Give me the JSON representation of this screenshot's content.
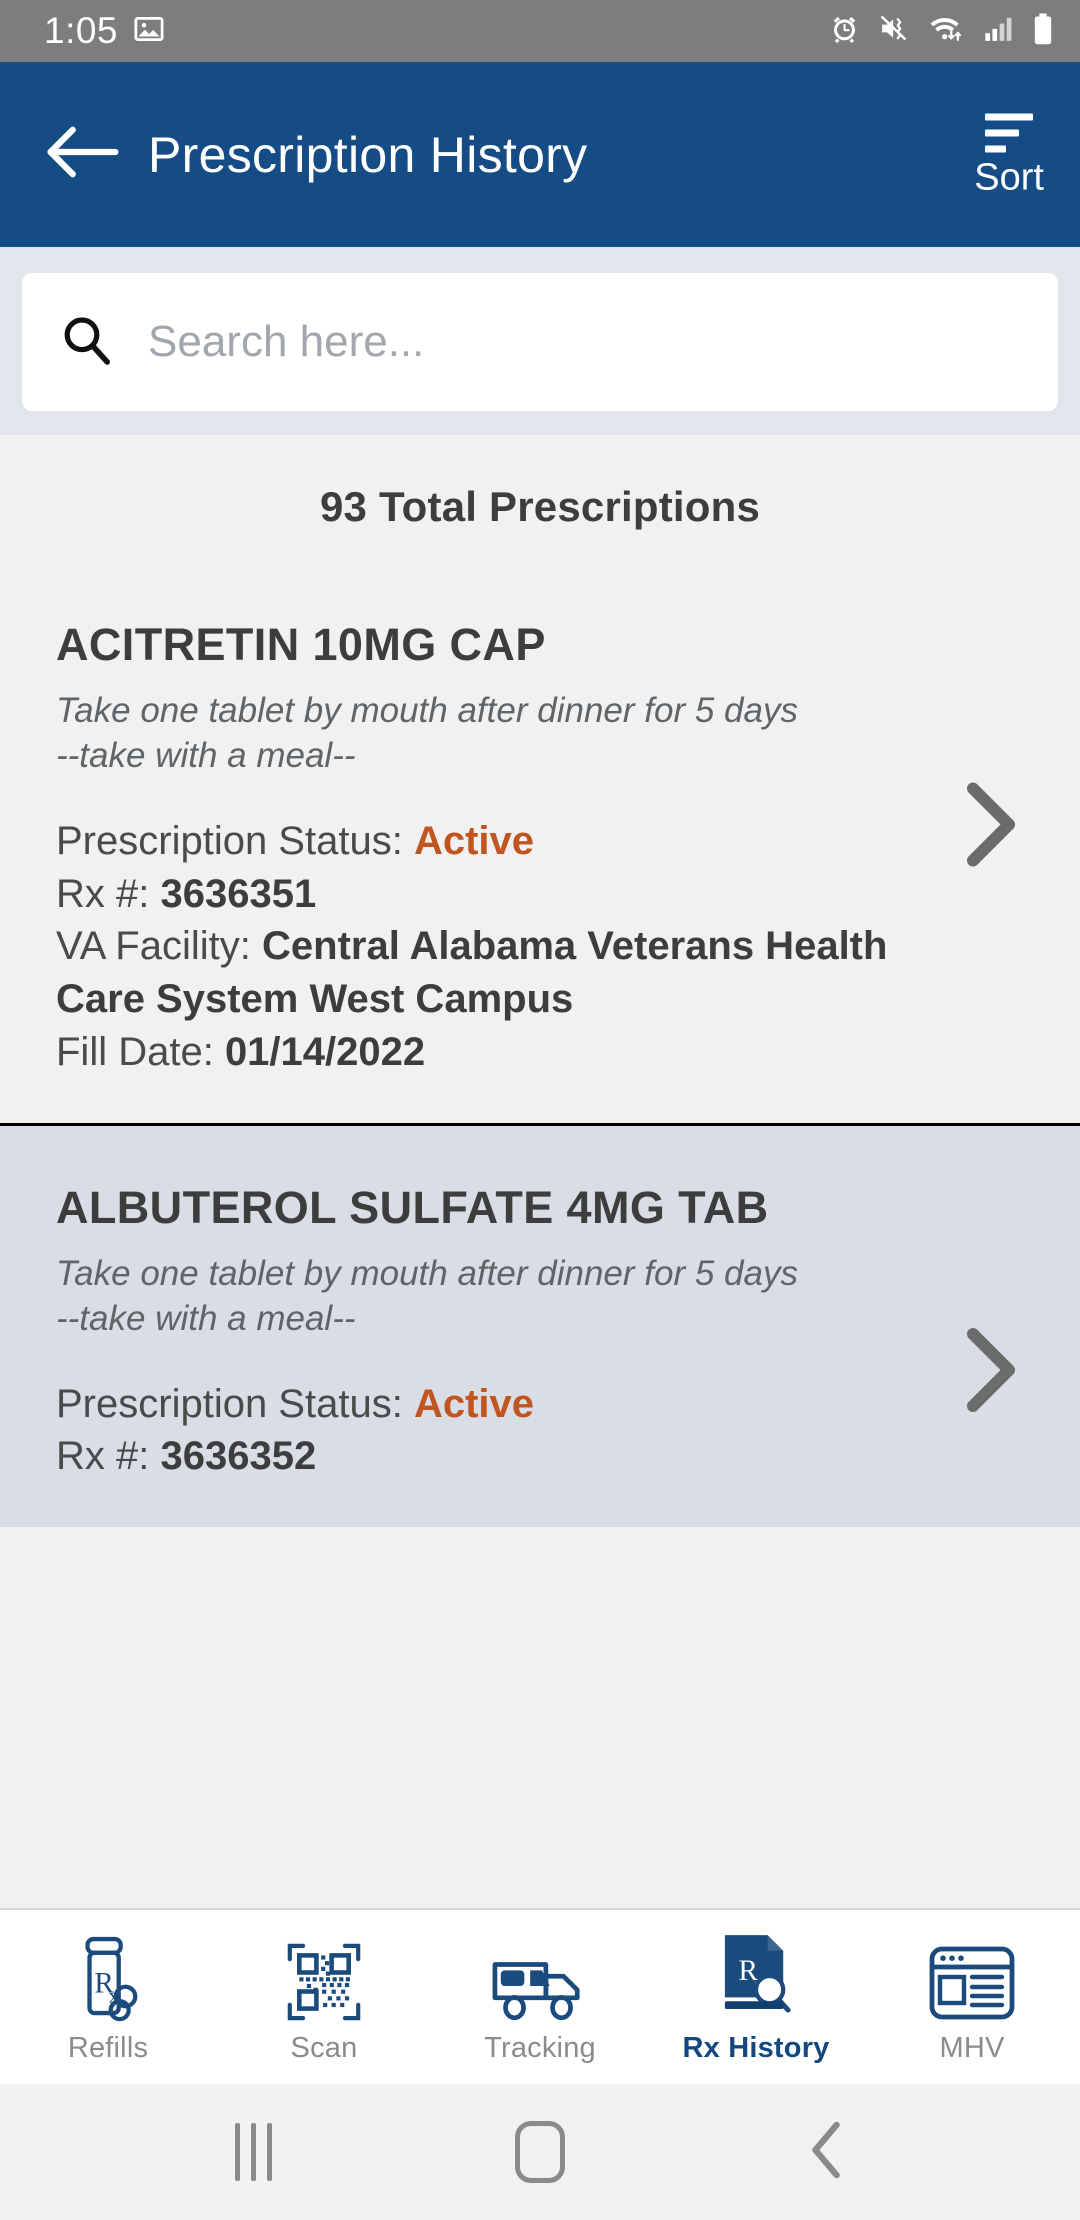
{
  "status_bar": {
    "time": "1:05",
    "icons": [
      "image-icon",
      "alarm-icon",
      "vibrate-icon",
      "wifi-icon",
      "signal-icon",
      "battery-icon"
    ]
  },
  "app_bar": {
    "back_icon": "back-arrow-icon",
    "title": "Prescription History",
    "sort_label": "Sort",
    "sort_icon": "sort-icon",
    "background_color": "#164c86"
  },
  "search": {
    "placeholder": "Search here...",
    "value": "",
    "icon": "search-icon"
  },
  "main": {
    "total_label": "93 Total Prescriptions",
    "status_color": "#c0551f",
    "prescriptions": [
      {
        "name": "ACITRETIN 10MG CAP",
        "sig_line1": "Take one tablet by mouth after dinner for 5 days",
        "sig_line2": "--take with a meal--",
        "status_label": "Prescription Status:",
        "status_value": "Active",
        "rx_label": "Rx #:",
        "rx_value": "3636351",
        "facility_label": "VA Facility:",
        "facility_value": "Central Alabama Veterans Health Care System West Campus",
        "fill_label": "Fill Date:",
        "fill_value": "01/14/2022",
        "chevron_icon": "chevron-right-icon"
      },
      {
        "name": "ALBUTEROL SULFATE 4MG TAB",
        "sig_line1": "Take one tablet by mouth after dinner for 5 days",
        "sig_line2": "--take with a meal--",
        "status_label": "Prescription Status:",
        "status_value": "Active",
        "rx_label": "Rx #:",
        "rx_value": "3636352",
        "chevron_icon": "chevron-right-icon"
      }
    ]
  },
  "tabs": [
    {
      "label": "Refills",
      "icon": "pill-bottle-rx-icon",
      "active": false
    },
    {
      "label": "Scan",
      "icon": "qr-code-icon",
      "active": false
    },
    {
      "label": "Tracking",
      "icon": "delivery-truck-icon",
      "active": false
    },
    {
      "label": "Rx History",
      "icon": "rx-document-search-icon",
      "active": true
    },
    {
      "label": "MHV",
      "icon": "browser-window-icon",
      "active": false
    }
  ],
  "system_nav": {
    "recents_icon": "recents-icon",
    "home_icon": "home-icon",
    "back_icon": "back-chevron-icon"
  }
}
